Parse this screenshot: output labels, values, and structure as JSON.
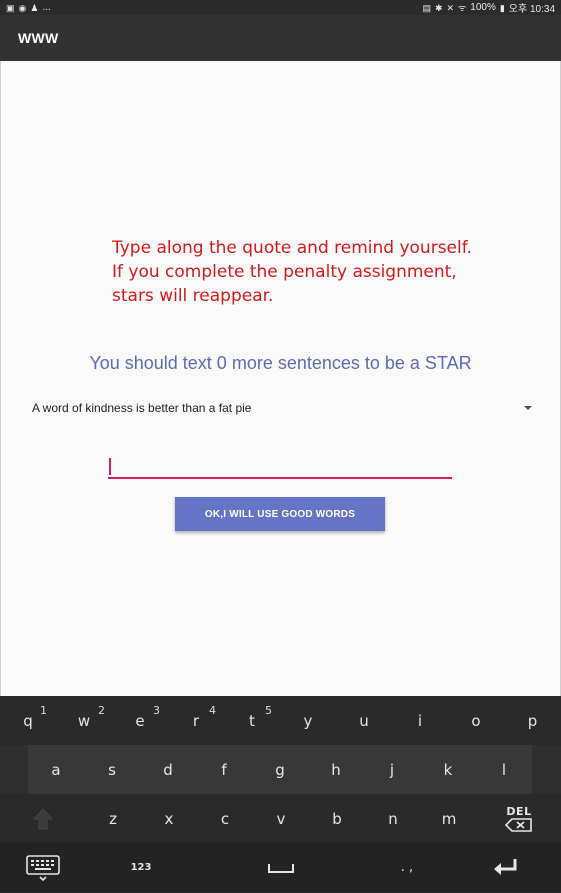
{
  "status_bar": {
    "left_icons": [
      "image-icon",
      "eye-icon",
      "person-icon"
    ],
    "ellipsis": "...",
    "battery": "100%",
    "time": "오후 10:34"
  },
  "app_bar": {
    "title": "WWW"
  },
  "penalty_message": {
    "lines": [
      "Type along the quote and remind yourself.",
      "If you complete the penalty assignment,",
      "stars will reappear."
    ],
    "color": "#d11a1a"
  },
  "star_message": "You should text 0 more sentences to be a STAR",
  "quote_spinner": {
    "selected": "A word of kindness is better than a fat pie"
  },
  "sentence_input": {
    "value": ""
  },
  "ok_button": {
    "label": "OK,I WILL USE GOOD WORDS",
    "color": "#6574c4"
  },
  "keyboard": {
    "row1": [
      {
        "key": "q",
        "num": "1"
      },
      {
        "key": "w",
        "num": "2"
      },
      {
        "key": "e",
        "num": "3"
      },
      {
        "key": "r",
        "num": "4"
      },
      {
        "key": "t",
        "num": "5"
      },
      {
        "key": "y",
        "num": ""
      },
      {
        "key": "u",
        "num": ""
      },
      {
        "key": "i",
        "num": ""
      },
      {
        "key": "o",
        "num": ""
      },
      {
        "key": "p",
        "num": ""
      }
    ],
    "row2": [
      "a",
      "s",
      "d",
      "f",
      "g",
      "h",
      "j",
      "k",
      "l"
    ],
    "row3": [
      "z",
      "x",
      "c",
      "v",
      "b",
      "n",
      "m"
    ],
    "del_label": "DEL",
    "symbols_label": "123",
    "punct_label": ". ,"
  }
}
